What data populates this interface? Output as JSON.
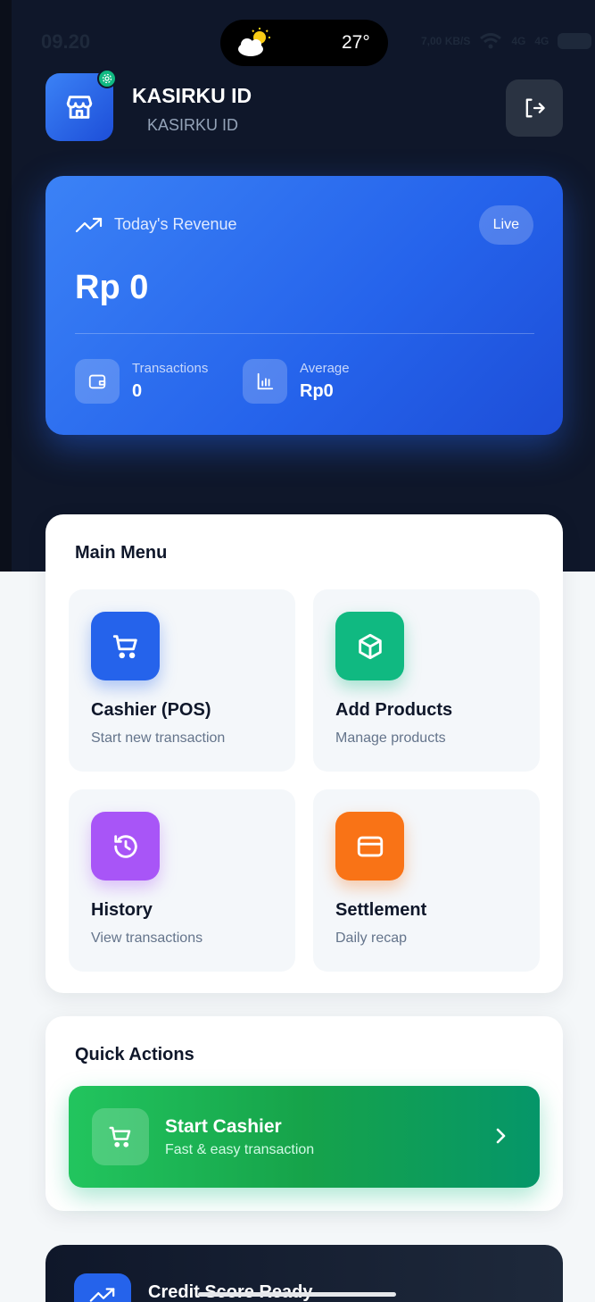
{
  "status_bar": {
    "time": "09.20",
    "temperature": "27°",
    "network_labels": [
      "7,00 KB/S",
      "4G",
      "4G"
    ]
  },
  "header": {
    "store_name": "KASIRKU ID",
    "store_subtitle": "KASIRKU ID"
  },
  "revenue": {
    "title": "Today's Revenue",
    "live_label": "Live",
    "amount": "Rp 0",
    "transactions_label": "Transactions",
    "transactions_value": "0",
    "average_label": "Average",
    "average_value": "Rp0"
  },
  "main_menu": {
    "title": "Main Menu",
    "items": [
      {
        "title": "Cashier (POS)",
        "subtitle": "Start new transaction",
        "color": "#2563eb",
        "icon": "cart-icon"
      },
      {
        "title": "Add Products",
        "subtitle": "Manage products",
        "color": "#10b981",
        "icon": "box-icon"
      },
      {
        "title": "History",
        "subtitle": "View transactions",
        "color": "#a855f7",
        "icon": "history-icon"
      },
      {
        "title": "Settlement",
        "subtitle": "Daily recap",
        "color": "#f97316",
        "icon": "card-icon"
      }
    ]
  },
  "quick_actions": {
    "title": "Quick Actions",
    "start_title": "Start Cashier",
    "start_subtitle": "Fast & easy transaction"
  },
  "credit": {
    "title": "Credit Score Ready"
  }
}
